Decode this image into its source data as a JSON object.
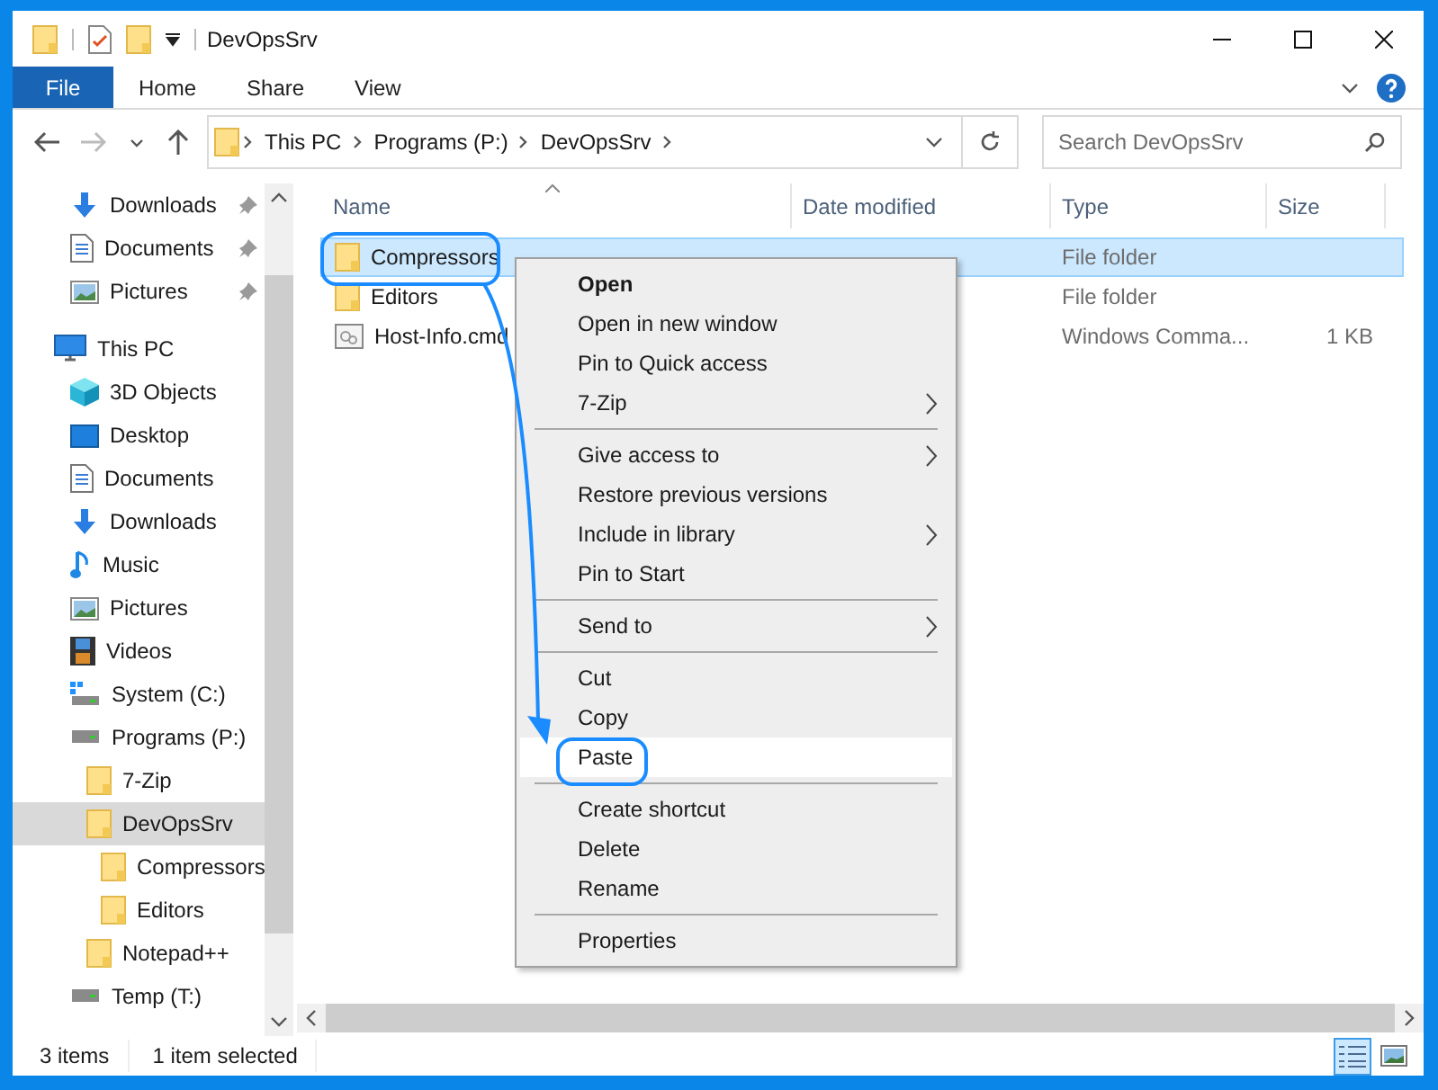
{
  "window": {
    "title": "DevOpsSrv"
  },
  "ribbon": {
    "file_tab": "File",
    "tabs": [
      "Home",
      "Share",
      "View"
    ]
  },
  "address": {
    "path": [
      "This PC",
      "Programs (P:)",
      "DevOpsSrv"
    ]
  },
  "search": {
    "placeholder": "Search DevOpsSrv"
  },
  "nav": {
    "quick_access": [
      {
        "label": "Downloads",
        "kind": "download",
        "pinned": true,
        "selected": false
      },
      {
        "label": "Documents",
        "kind": "document",
        "pinned": true,
        "selected": false
      },
      {
        "label": "Pictures",
        "kind": "picture",
        "pinned": true,
        "selected": false
      }
    ],
    "tree": [
      {
        "label": "This PC",
        "kind": "pc",
        "selected": false,
        "children": [
          {
            "label": "3D Objects",
            "kind": "cube",
            "selected": false
          },
          {
            "label": "Desktop",
            "kind": "desktop",
            "selected": false
          },
          {
            "label": "Documents",
            "kind": "document",
            "selected": false
          },
          {
            "label": "Downloads",
            "kind": "download",
            "selected": false
          },
          {
            "label": "Music",
            "kind": "music",
            "selected": false
          },
          {
            "label": "Pictures",
            "kind": "picture",
            "selected": false
          },
          {
            "label": "Videos",
            "kind": "video",
            "selected": false
          },
          {
            "label": "System (C:)",
            "kind": "system_drive",
            "selected": false
          },
          {
            "label": "Programs (P:)",
            "kind": "drive",
            "selected": false,
            "children": [
              {
                "label": "7-Zip",
                "kind": "folder",
                "selected": false
              },
              {
                "label": "DevOpsSrv",
                "kind": "folder",
                "selected": true,
                "children": [
                  {
                    "label": "Compressors",
                    "kind": "folder",
                    "selected": false
                  },
                  {
                    "label": "Editors",
                    "kind": "folder",
                    "selected": false
                  }
                ]
              },
              {
                "label": "Notepad++",
                "kind": "folder",
                "selected": false
              }
            ]
          },
          {
            "label": "Temp (T:)",
            "kind": "drive",
            "selected": false
          }
        ]
      }
    ]
  },
  "columns": [
    "Name",
    "Date modified",
    "Type",
    "Size"
  ],
  "rows": [
    {
      "name": "Compressors",
      "kind": "folder",
      "type": "File folder",
      "selected": true
    },
    {
      "name": "Editors",
      "kind": "folder",
      "type": "File folder",
      "selected": false
    },
    {
      "name": "Host-Info.cmd",
      "kind": "script",
      "type": "Windows Comma...",
      "size": "1 KB",
      "selected": false
    }
  ],
  "context_menu": {
    "groups": [
      [
        {
          "label": "Open",
          "bold": true,
          "submenu": false,
          "highlighted": false
        },
        {
          "label": "Open in new window",
          "bold": false,
          "submenu": false,
          "highlighted": false
        },
        {
          "label": "Pin to Quick access",
          "bold": false,
          "submenu": false,
          "highlighted": false
        },
        {
          "label": "7-Zip",
          "bold": false,
          "submenu": true,
          "highlighted": false
        }
      ],
      [
        {
          "label": "Give access to",
          "bold": false,
          "submenu": true,
          "highlighted": false
        },
        {
          "label": "Restore previous versions",
          "bold": false,
          "submenu": false,
          "highlighted": false
        },
        {
          "label": "Include in library",
          "bold": false,
          "submenu": true,
          "highlighted": false
        },
        {
          "label": "Pin to Start",
          "bold": false,
          "submenu": false,
          "highlighted": false
        }
      ],
      [
        {
          "label": "Send to",
          "bold": false,
          "submenu": true,
          "highlighted": false
        }
      ],
      [
        {
          "label": "Cut",
          "bold": false,
          "submenu": false,
          "highlighted": false
        },
        {
          "label": "Copy",
          "bold": false,
          "submenu": false,
          "highlighted": false
        },
        {
          "label": "Paste",
          "bold": false,
          "submenu": false,
          "highlighted": true
        }
      ],
      [
        {
          "label": "Create shortcut",
          "bold": false,
          "submenu": false,
          "highlighted": false
        },
        {
          "label": "Delete",
          "bold": false,
          "submenu": false,
          "highlighted": false
        },
        {
          "label": "Rename",
          "bold": false,
          "submenu": false,
          "highlighted": false
        }
      ],
      [
        {
          "label": "Properties",
          "bold": false,
          "submenu": false,
          "highlighted": false
        }
      ]
    ]
  },
  "status_bar": {
    "item_count": "3 items",
    "selection": "1 item selected"
  },
  "view_buttons": [
    {
      "kind": "details",
      "selected": true
    },
    {
      "kind": "thumbnails",
      "selected": false
    }
  ]
}
